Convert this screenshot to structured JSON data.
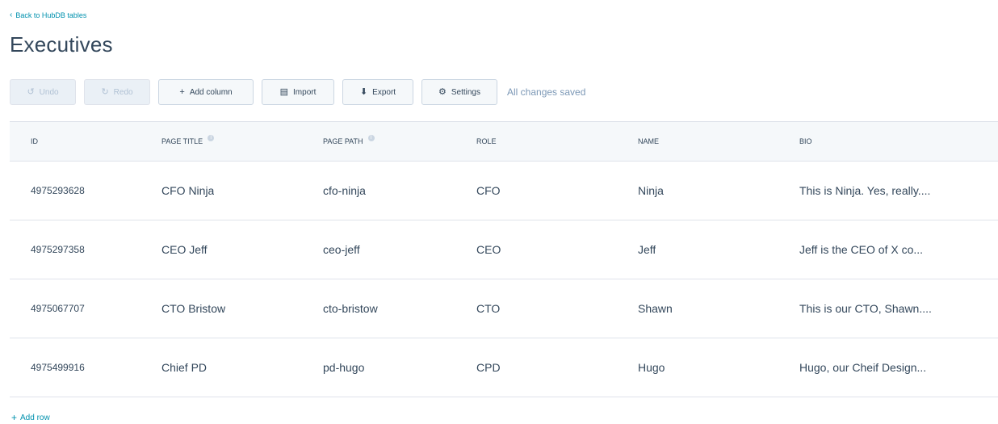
{
  "nav": {
    "back_label": "Back to HubDB tables",
    "back_icon": "chevron-left-icon"
  },
  "page": {
    "title": "Executives"
  },
  "toolbar": {
    "undo_label": "Undo",
    "redo_label": "Redo",
    "add_column_label": "Add column",
    "import_label": "Import",
    "export_label": "Export",
    "settings_label": "Settings",
    "status": "All changes saved"
  },
  "table": {
    "headers": [
      "ID",
      "PAGE TITLE",
      "PAGE PATH",
      "ROLE",
      "NAME",
      "BIO"
    ],
    "rows": [
      [
        "4975293628",
        "CFO Ninja",
        "cfo-ninja",
        "CFO",
        "Ninja",
        "This is Ninja. Yes, really...."
      ],
      [
        "4975297358",
        "CEO Jeff",
        "ceo-jeff",
        "CEO",
        "Jeff",
        "Jeff is the CEO of X co..."
      ],
      [
        "4975067707",
        "CTO Bristow",
        "cto-bristow",
        "CTO",
        "Shawn",
        "This is our CTO, Shawn...."
      ],
      [
        "4975499916",
        "Chief PD",
        "pd-hugo",
        "CPD",
        "Hugo",
        "Hugo, our Cheif Design..."
      ]
    ]
  },
  "footer": {
    "add_row_label": "Add row"
  },
  "colors": {
    "accent": "#0091ae",
    "text": "#33475b",
    "header_bg": "#f5f8fa",
    "border": "#dfe3eb"
  }
}
